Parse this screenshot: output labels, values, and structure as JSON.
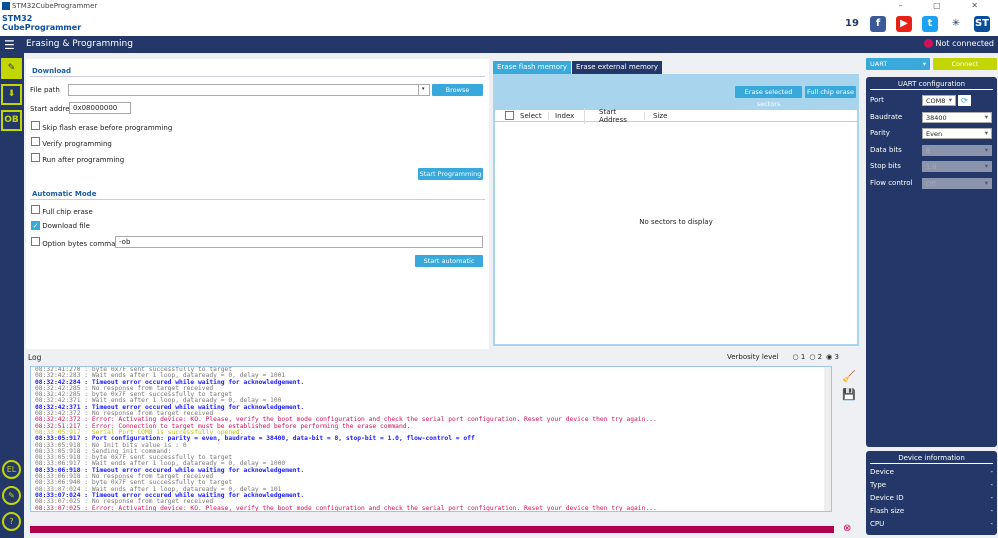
{
  "window": {
    "title": "STM32CubeProgrammer",
    "controls": "– ▢ ✕"
  },
  "logo": {
    "line1": "STM32",
    "line2": "CubeProgrammer"
  },
  "social": [
    {
      "name": "anniversary-icon",
      "glyph": "19",
      "color": "#fff"
    },
    {
      "name": "facebook-icon",
      "glyph": "f",
      "color": "#3b5998"
    },
    {
      "name": "youtube-icon",
      "glyph": "▶",
      "color": "#e62117"
    },
    {
      "name": "twitter-icon",
      "glyph": "t",
      "color": "#1da1f2"
    },
    {
      "name": "network-icon",
      "glyph": "✳",
      "color": "#fff"
    },
    {
      "name": "st-logo-icon",
      "glyph": "ST",
      "color": "#0a4e9b"
    }
  ],
  "topbar": {
    "title": "Erasing & Programming",
    "status": "Not connected"
  },
  "sidebar": {
    "items": [
      "✎",
      "⬇",
      "OB"
    ],
    "bottom": [
      "EL",
      "✎",
      "?"
    ]
  },
  "download": {
    "section": "Download",
    "file_path_label": "File path",
    "file_path_value": "",
    "browse": "Browse",
    "start_address_label": "Start address",
    "start_address_value": "0x08000000",
    "skip_erase": "Skip flash erase before programming",
    "verify": "Verify programming",
    "run_after": "Run after programming",
    "start_programming": "Start Programming"
  },
  "automatic": {
    "section": "Automatic Mode",
    "full_chip_erase": "Full chip erase",
    "download_file": "Download file",
    "option_bytes": "Option bytes commands",
    "option_bytes_value": "-ob",
    "start_automatic": "Start automatic mode"
  },
  "erase": {
    "tabs": [
      "Erase flash memory",
      "Erase external memory"
    ],
    "erase_selected": "Erase selected sectors",
    "full_chip_erase": "Full chip erase",
    "columns": [
      "Select",
      "Index",
      "Start Address",
      "Size"
    ],
    "empty": "No sectors to display"
  },
  "log": {
    "title": "Log",
    "verbosity_label": "Verbosity level",
    "levels": [
      "1",
      "2",
      "3"
    ],
    "selected_level": "3",
    "progress": 100,
    "lines": [
      {
        "c": "g",
        "t": "08:32:41:270 : byte 0x7F sent successfully to target"
      },
      {
        "c": "g",
        "t": "08:32:42:283 : Wait ends after 1 loop, dataready = 0, delay = 1001"
      },
      {
        "c": "b",
        "t": "08:32:42:284 : Timeout error occured while waiting for acknowledgement."
      },
      {
        "c": "g",
        "t": "08:32:42:285 : No response from target received"
      },
      {
        "c": "g",
        "t": "08:32:42:285 : byte 0x7F sent successfully to target"
      },
      {
        "c": "g",
        "t": "08:32:42:371 : Wait ends after 1 loop, dataready = 0, delay = 100"
      },
      {
        "c": "b",
        "t": "08:32:42:371 : Timeout error occured while waiting for acknowledgement."
      },
      {
        "c": "g",
        "t": "08:32:42:372 : No response from target received"
      },
      {
        "c": "r",
        "t": "08:32:42:372 : Error: Activating device: KO. Please, verify the boot mode configuration and check the serial port configuration. Reset your device then try again..."
      },
      {
        "c": "r",
        "t": "08:32:51:217 : Error: Connection to target must be established before performing the erase command."
      },
      {
        "c": "y",
        "t": "08:33:05:917 : Serial Port COM8 is successfully opened."
      },
      {
        "c": "b",
        "t": "08:33:05:917 : Port configuration: parity = even, baudrate = 38400, data-bit = 8, stop-bit = 1.0, flow-control = off"
      },
      {
        "c": "g",
        "t": "08:33:05:918 : No Init bits value is : 0"
      },
      {
        "c": "g",
        "t": "08:33:05:918 : Sending init command:"
      },
      {
        "c": "g",
        "t": "08:33:05:918 : byte 0x7F sent successfully to target"
      },
      {
        "c": "g",
        "t": "08:33:06:917 : Wait ends after 1 loop, dataready = 0, delay = 1000"
      },
      {
        "c": "b",
        "t": "08:33:06:918 : Timeout error occured while waiting for acknowledgement."
      },
      {
        "c": "g",
        "t": "08:33:06:918 : No response from target received"
      },
      {
        "c": "g",
        "t": "08:33:06:940 : byte 0x7F sent successfully to target"
      },
      {
        "c": "g",
        "t": "08:33:07:024 : Wait ends after 1 loop, dataready = 0, delay = 101"
      },
      {
        "c": "b",
        "t": "08:33:07:024 : Timeout error occured while waiting for acknowledgement."
      },
      {
        "c": "g",
        "t": "08:33:07:025 : No response from target received"
      },
      {
        "c": "r",
        "t": "08:33:07:025 : Error: Activating device: KO. Please, verify the boot mode configuration and check the serial port configuration. Reset your device then try again..."
      }
    ]
  },
  "connection": {
    "interface": "UART",
    "connect": "Connect",
    "config_title": "UART configuration",
    "fields": [
      {
        "label": "Port",
        "value": "COM8",
        "disabled": false
      },
      {
        "label": "Baudrate",
        "value": "38400",
        "disabled": false
      },
      {
        "label": "Parity",
        "value": "Even",
        "disabled": false
      },
      {
        "label": "Data bits",
        "value": "8",
        "disabled": true
      },
      {
        "label": "Stop bits",
        "value": "1.0",
        "disabled": true
      },
      {
        "label": "Flow control",
        "value": "Off",
        "disabled": true
      }
    ]
  },
  "device_info": {
    "title": "Device information",
    "rows": [
      {
        "label": "Device",
        "value": "-"
      },
      {
        "label": "Type",
        "value": "-"
      },
      {
        "label": "Device ID",
        "value": "-"
      },
      {
        "label": "Flash size",
        "value": "-"
      },
      {
        "label": "CPU",
        "value": "-"
      }
    ]
  },
  "colors": {
    "navy": "#233868",
    "accent": "#39a9dc",
    "lime": "#c4d600",
    "error": "#d0105a"
  }
}
